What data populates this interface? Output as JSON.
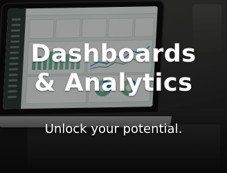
{
  "banner": {
    "headline_line1": "Dashboards",
    "headline_line2": "& Analytics",
    "tagline": "Unlock your potential."
  },
  "colors": {
    "text": "#ffffff",
    "dashboard_accent": "#6cb89a"
  },
  "background": {
    "subject": "laptop-showing-analytics-dashboard"
  }
}
